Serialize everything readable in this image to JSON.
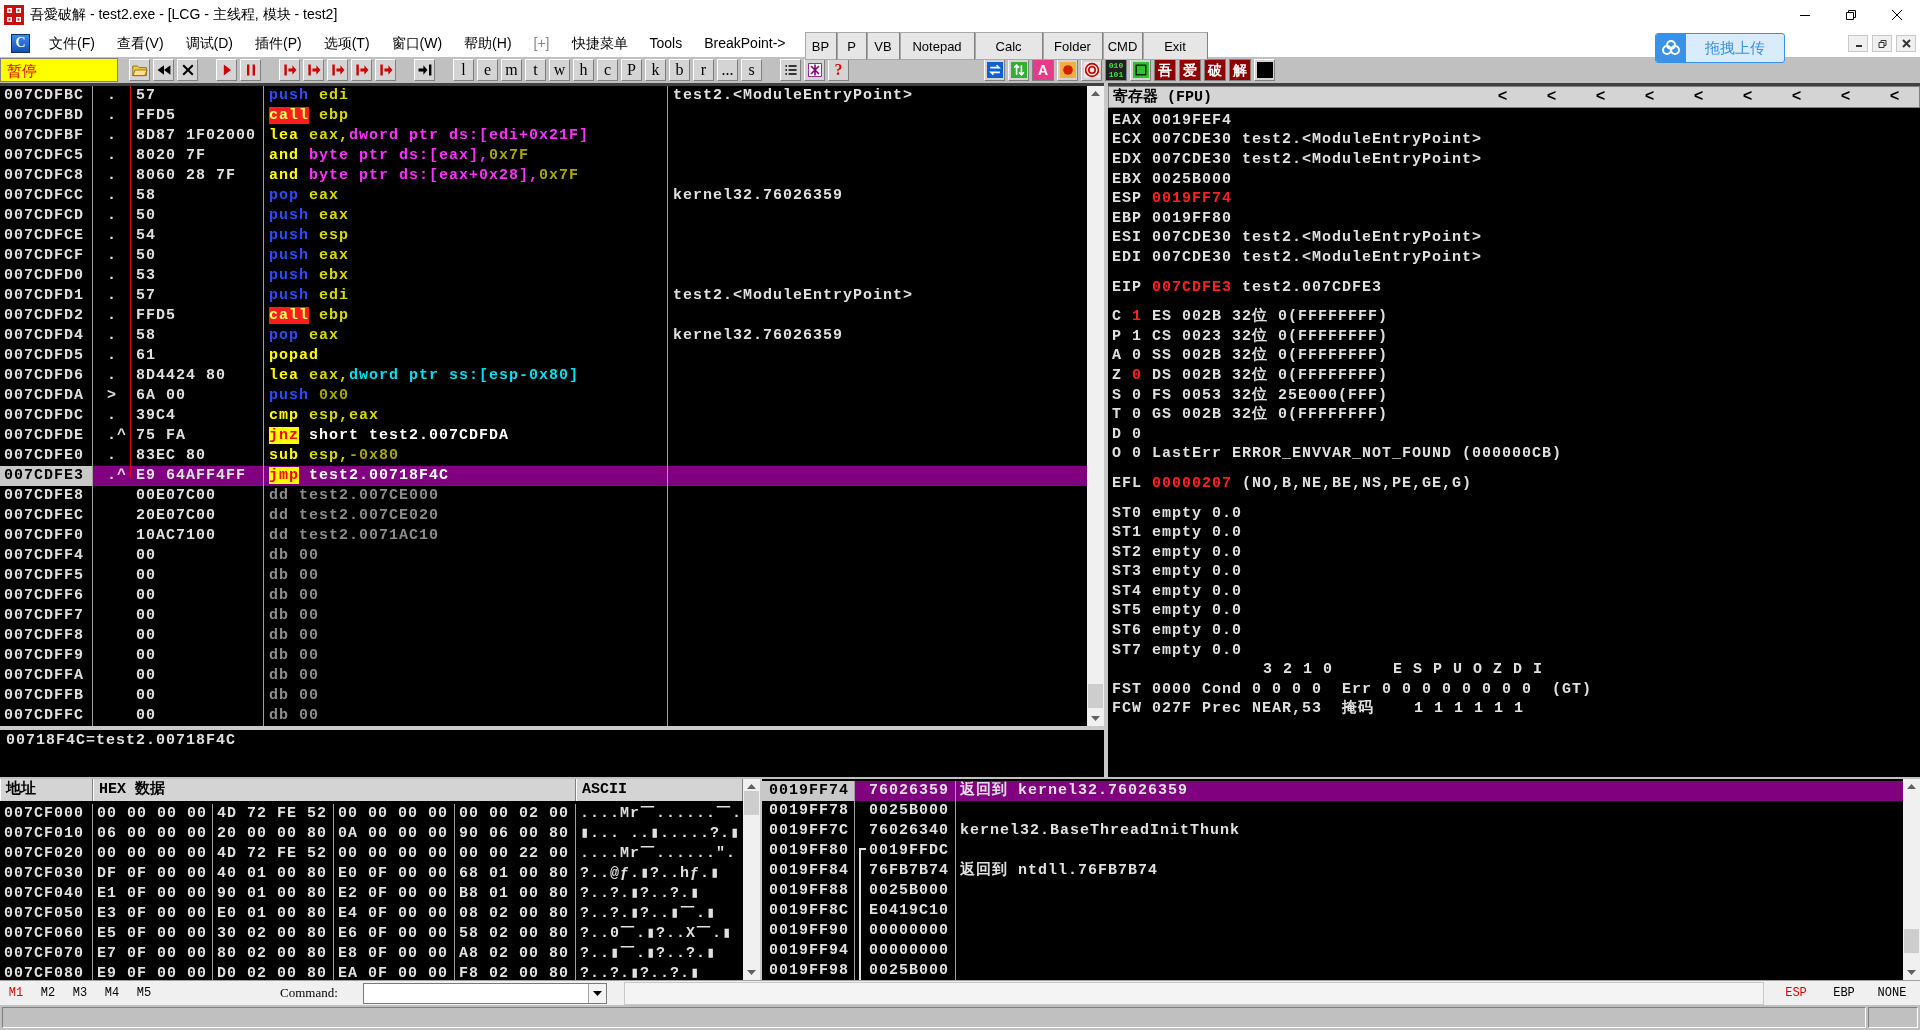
{
  "window": {
    "title": "吾愛破解 - test2.exe - [LCG -  主线程, 模块 - test2]"
  },
  "menu": {
    "badge": "C",
    "items": [
      {
        "label": "文件(F)",
        "disabled": false
      },
      {
        "label": "查看(V)",
        "disabled": false
      },
      {
        "label": "调试(D)",
        "disabled": false
      },
      {
        "label": "插件(P)",
        "disabled": false
      },
      {
        "label": "选项(T)",
        "disabled": false
      },
      {
        "label": "窗口(W)",
        "disabled": false
      },
      {
        "label": "帮助(H)",
        "disabled": false
      },
      {
        "label": "[+]",
        "disabled": true
      },
      {
        "label": "快捷菜单",
        "disabled": false
      },
      {
        "label": "Tools",
        "disabled": false
      },
      {
        "label": "BreakPoint->",
        "disabled": false
      }
    ],
    "quick_buttons": [
      "BP",
      "P",
      "VB",
      "Notepad",
      "Calc",
      "Folder",
      "CMD",
      "Exit"
    ],
    "upload_button": "拖拽上传"
  },
  "toolbar": {
    "status": "暂停",
    "letters": [
      "l",
      "e",
      "m",
      "t",
      "w",
      "h",
      "c",
      "P",
      "k",
      "b",
      "r",
      "...",
      "s"
    ],
    "help": "?",
    "badges": [
      "A",
      "010",
      "101",
      "吾",
      "爱",
      "破",
      "解"
    ]
  },
  "disassembly": {
    "rows": [
      {
        "address": "007CDFBC",
        "mark": ".",
        "hex": "57",
        "mnemonic": "push",
        "kind": "stack",
        "operands": [
          {
            "text": "edi",
            "kind": "reg"
          }
        ],
        "comment": "test2.<ModuleEntryPoint>",
        "selected": false
      },
      {
        "address": "007CDFBD",
        "mark": ".",
        "hex": "FFD5",
        "mnemonic": "call",
        "kind": "call",
        "operands": [
          {
            "text": "ebp",
            "kind": "reg"
          }
        ],
        "selected": false
      },
      {
        "address": "007CDFBF",
        "mark": ".",
        "hex": "8D87 1F02000",
        "mnemonic": "lea",
        "kind": "alu",
        "operands": [
          {
            "text": "eax,",
            "kind": "reg"
          },
          {
            "text": "dword ptr ds:[edi+0x21F]",
            "kind": "mem_ds"
          }
        ],
        "selected": false
      },
      {
        "address": "007CDFC5",
        "mark": ".",
        "hex": "8020 7F",
        "mnemonic": "and",
        "kind": "alu",
        "operands": [
          {
            "text": "byte ptr ds:[eax],",
            "kind": "mem_ds"
          },
          {
            "text": "0x7F",
            "kind": "imm"
          }
        ],
        "selected": false
      },
      {
        "address": "007CDFC8",
        "mark": ".",
        "hex": "8060 28 7F",
        "mnemonic": "and",
        "kind": "alu",
        "operands": [
          {
            "text": "byte ptr ds:[eax+0x28],",
            "kind": "mem_ds"
          },
          {
            "text": "0x7F",
            "kind": "imm"
          }
        ],
        "selected": false
      },
      {
        "address": "007CDFCC",
        "mark": ".",
        "hex": "58",
        "mnemonic": "pop",
        "kind": "stack",
        "operands": [
          {
            "text": "eax",
            "kind": "reg"
          }
        ],
        "comment": "kernel32.76026359",
        "selected": false
      },
      {
        "address": "007CDFCD",
        "mark": ".",
        "hex": "50",
        "mnemonic": "push",
        "kind": "stack",
        "operands": [
          {
            "text": "eax",
            "kind": "reg"
          }
        ],
        "selected": false
      },
      {
        "address": "007CDFCE",
        "mark": ".",
        "hex": "54",
        "mnemonic": "push",
        "kind": "stack",
        "operands": [
          {
            "text": "esp",
            "kind": "reg"
          }
        ],
        "selected": false
      },
      {
        "address": "007CDFCF",
        "mark": ".",
        "hex": "50",
        "mnemonic": "push",
        "kind": "stack",
        "operands": [
          {
            "text": "eax",
            "kind": "reg"
          }
        ],
        "selected": false
      },
      {
        "address": "007CDFD0",
        "mark": ".",
        "hex": "53",
        "mnemonic": "push",
        "kind": "stack",
        "operands": [
          {
            "text": "ebx",
            "kind": "reg"
          }
        ],
        "selected": false
      },
      {
        "address": "007CDFD1",
        "mark": ".",
        "hex": "57",
        "mnemonic": "push",
        "kind": "stack",
        "operands": [
          {
            "text": "edi",
            "kind": "reg"
          }
        ],
        "comment": "test2.<ModuleEntryPoint>",
        "selected": false
      },
      {
        "address": "007CDFD2",
        "mark": ".",
        "hex": "FFD5",
        "mnemonic": "call",
        "kind": "call",
        "operands": [
          {
            "text": "ebp",
            "kind": "reg"
          }
        ],
        "selected": false
      },
      {
        "address": "007CDFD4",
        "mark": ".",
        "hex": "58",
        "mnemonic": "pop",
        "kind": "stack",
        "operands": [
          {
            "text": "eax",
            "kind": "reg"
          }
        ],
        "comment": "kernel32.76026359",
        "selected": false
      },
      {
        "address": "007CDFD5",
        "mark": ".",
        "hex": "61",
        "mnemonic": "popad",
        "kind": "alu",
        "selected": false
      },
      {
        "address": "007CDFD6",
        "mark": ".",
        "hex": "8D4424 80",
        "mnemonic": "lea",
        "kind": "alu",
        "operands": [
          {
            "text": "eax,",
            "kind": "reg"
          },
          {
            "text": "dword ptr ss:[esp-0x80]",
            "kind": "mem_ss"
          }
        ],
        "selected": false
      },
      {
        "address": "007CDFDA",
        "mark": ">",
        "hex": "6A 00",
        "mnemonic": "push",
        "kind": "stack",
        "operands": [
          {
            "text": "0x0",
            "kind": "imm"
          }
        ],
        "selected": false
      },
      {
        "address": "007CDFDC",
        "mark": ".",
        "hex": "39C4",
        "mnemonic": "cmp",
        "kind": "alu",
        "operands": [
          {
            "text": "esp,eax",
            "kind": "reg"
          }
        ],
        "selected": false
      },
      {
        "address": "007CDFDE",
        "mark": ".^",
        "hex": "75 FA",
        "mnemonic": "jnz",
        "kind": "jump",
        "operands": [
          {
            "text": "short test2.007CDFDA",
            "kind": "target"
          }
        ],
        "selected": false
      },
      {
        "address": "007CDFE0",
        "mark": ".",
        "hex": "83EC 80",
        "mnemonic": "sub",
        "kind": "alu",
        "operands": [
          {
            "text": "esp,",
            "kind": "reg"
          },
          {
            "text": "-0x80",
            "kind": "imm"
          }
        ],
        "selected": false
      },
      {
        "address": "007CDFE3",
        "mark": ".^",
        "hex": "E9 64AFF4FF",
        "mnemonic": "jmp",
        "kind": "jump",
        "operands": [
          {
            "text": "test2.00718F4C",
            "kind": "target"
          }
        ],
        "selected": true
      },
      {
        "address": "007CDFE8",
        "hex": "00E07C00",
        "mnemonic": "dd",
        "kind": "data",
        "operands": [
          {
            "text": "test2.007CE000",
            "kind": "data"
          }
        ],
        "selected": false
      },
      {
        "address": "007CDFEC",
        "hex": "20E07C00",
        "mnemonic": "dd",
        "kind": "data",
        "operands": [
          {
            "text": "test2.007CE020",
            "kind": "data"
          }
        ],
        "selected": false
      },
      {
        "address": "007CDFF0",
        "hex": "10AC7100",
        "mnemonic": "dd",
        "kind": "data",
        "operands": [
          {
            "text": "test2.0071AC10",
            "kind": "data"
          }
        ],
        "selected": false
      },
      {
        "address": "007CDFF4",
        "hex": "00",
        "mnemonic": "db",
        "kind": "data",
        "operands": [
          {
            "text": "00",
            "kind": "data"
          }
        ],
        "selected": false
      },
      {
        "address": "007CDFF5",
        "hex": "00",
        "mnemonic": "db",
        "kind": "data",
        "operands": [
          {
            "text": "00",
            "kind": "data"
          }
        ],
        "selected": false
      },
      {
        "address": "007CDFF6",
        "hex": "00",
        "mnemonic": "db",
        "kind": "data",
        "operands": [
          {
            "text": "00",
            "kind": "data"
          }
        ],
        "selected": false
      },
      {
        "address": "007CDFF7",
        "hex": "00",
        "mnemonic": "db",
        "kind": "data",
        "operands": [
          {
            "text": "00",
            "kind": "data"
          }
        ],
        "selected": false
      },
      {
        "address": "007CDFF8",
        "hex": "00",
        "mnemonic": "db",
        "kind": "data",
        "operands": [
          {
            "text": "00",
            "kind": "data"
          }
        ],
        "selected": false
      },
      {
        "address": "007CDFF9",
        "hex": "00",
        "mnemonic": "db",
        "kind": "data",
        "operands": [
          {
            "text": "00",
            "kind": "data"
          }
        ],
        "selected": false
      },
      {
        "address": "007CDFFA",
        "hex": "00",
        "mnemonic": "db",
        "kind": "data",
        "operands": [
          {
            "text": "00",
            "kind": "data"
          }
        ],
        "selected": false
      },
      {
        "address": "007CDFFB",
        "hex": "00",
        "mnemonic": "db",
        "kind": "data",
        "operands": [
          {
            "text": "00",
            "kind": "data"
          }
        ],
        "selected": false
      },
      {
        "address": "007CDFFC",
        "hex": "00",
        "mnemonic": "db",
        "kind": "data",
        "operands": [
          {
            "text": "00",
            "kind": "data"
          }
        ],
        "selected": false
      }
    ],
    "info": "00718F4C=test2.00718F4C"
  },
  "registers": {
    "title": "寄存器 (FPU)",
    "arrows": [
      "<",
      "<",
      "<",
      "<",
      "<",
      "<",
      "<",
      "<",
      "<"
    ],
    "groups": [
      [
        {
          "label": "EAX",
          "value": "0019FEF4",
          "changed": false
        },
        {
          "label": "ECX",
          "value": "007CDE30",
          "changed": false,
          "comment": "test2.<ModuleEntryPoint>"
        },
        {
          "label": "EDX",
          "value": "007CDE30",
          "changed": false,
          "comment": "test2.<ModuleEntryPoint>"
        },
        {
          "label": "EBX",
          "value": "0025B000",
          "changed": false
        },
        {
          "label": "ESP",
          "value": "0019FF74",
          "changed": true
        },
        {
          "label": "EBP",
          "value": "0019FF80",
          "changed": false
        },
        {
          "label": "ESI",
          "value": "007CDE30",
          "changed": false,
          "comment": "test2.<ModuleEntryPoint>"
        },
        {
          "label": "EDI",
          "value": "007CDE30",
          "changed": false,
          "comment": "test2.<ModuleEntryPoint>"
        }
      ],
      [
        {
          "label": "EIP",
          "value": "007CDFE3",
          "changed": true,
          "comment": "test2.007CDFE3"
        }
      ],
      [
        {
          "label": "C",
          "value": "1",
          "changed": true,
          "comment": "ES 002B 32位 0(FFFFFFFF)"
        },
        {
          "label": "P",
          "value": "1",
          "changed": false,
          "comment": "CS 0023 32位 0(FFFFFFFF)"
        },
        {
          "label": "A",
          "value": "0",
          "changed": false,
          "comment": "SS 002B 32位 0(FFFFFFFF)"
        },
        {
          "label": "Z",
          "value": "0",
          "changed": true,
          "comment": "DS 002B 32位 0(FFFFFFFF)"
        },
        {
          "label": "S",
          "value": "0",
          "changed": false,
          "comment": "FS 0053 32位 25E000(FFF)"
        },
        {
          "label": "T",
          "value": "0",
          "changed": false,
          "comment": "GS 002B 32位 0(FFFFFFFF)"
        },
        {
          "label": "D",
          "value": "0",
          "changed": false
        },
        {
          "label": "O",
          "value": "0",
          "changed": false,
          "comment": "LastErr ERROR_ENVVAR_NOT_FOUND (000000CB)"
        }
      ],
      [
        {
          "label": "EFL",
          "value": "00000207",
          "changed": true,
          "comment": "(NO,B,NE,BE,NS,PE,GE,G)"
        }
      ],
      [
        {
          "label": "ST0",
          "comment": "empty 0.0"
        },
        {
          "label": "ST1",
          "comment": "empty 0.0"
        },
        {
          "label": "ST2",
          "comment": "empty 0.0"
        },
        {
          "label": "ST3",
          "comment": "empty 0.0"
        },
        {
          "label": "ST4",
          "comment": "empty 0.0"
        },
        {
          "label": "ST5",
          "comment": "empty 0.0"
        },
        {
          "label": "ST6",
          "comment": "empty 0.0"
        },
        {
          "label": "ST7",
          "comment": "empty 0.0"
        },
        {
          "comment": "3 2 1 0      E S P U O Z D I"
        },
        {
          "label": "FST",
          "value": "0000",
          "changed": false,
          "comment": "Cond 0 0 0 0  Err 0 0 0 0 0 0 0 0  (GT)"
        },
        {
          "label": "FCW",
          "value": "027F",
          "changed": false,
          "comment": "Prec NEAR,53  掩码    1 1 1 1 1 1"
        }
      ]
    ]
  },
  "dump": {
    "columns": [
      "地址",
      "HEX 数据",
      "ASCII"
    ],
    "rows": [
      {
        "address": "007CF000",
        "bytes": [
          "00 00 00 00",
          "4D 72 FE 52",
          "00 00 00 00",
          "00 00 02 00"
        ],
        "ascii": "....Mr￣......￣."
      },
      {
        "address": "007CF010",
        "bytes": [
          "06 00 00 00",
          "20 00 00 80",
          "0A 00 00 00",
          "90 06 00 80"
        ],
        "ascii": "▮... ..▮.....?.▮"
      },
      {
        "address": "007CF020",
        "bytes": [
          "00 00 00 00",
          "4D 72 FE 52",
          "00 00 00 00",
          "00 00 22 00"
        ],
        "ascii": "....Mr￣......\"."
      },
      {
        "address": "007CF030",
        "bytes": [
          "DF 0F 00 00",
          "40 01 00 80",
          "E0 0F 00 00",
          "68 01 00 80"
        ],
        "ascii": "?..@ƒ.▮?..hƒ.▮"
      },
      {
        "address": "007CF040",
        "bytes": [
          "E1 0F 00 00",
          "90 01 00 80",
          "E2 0F 00 00",
          "B8 01 00 80"
        ],
        "ascii": "?..?.▮?..?.▮"
      },
      {
        "address": "007CF050",
        "bytes": [
          "E3 0F 00 00",
          "E0 01 00 80",
          "E4 0F 00 00",
          "08 02 00 80"
        ],
        "ascii": "?..?.▮?..▮￣.▮"
      },
      {
        "address": "007CF060",
        "bytes": [
          "E5 0F 00 00",
          "30 02 00 80",
          "E6 0F 00 00",
          "58 02 00 80"
        ],
        "ascii": "?..0￣.▮?..X￣.▮"
      },
      {
        "address": "007CF070",
        "bytes": [
          "E7 0F 00 00",
          "80 02 00 80",
          "E8 0F 00 00",
          "A8 02 00 80"
        ],
        "ascii": "?..▮￣.▮?..?.▮"
      },
      {
        "address": "007CF080",
        "bytes": [
          "E9 0F 00 00",
          "D0 02 00 80",
          "EA 0F 00 00",
          "F8 02 00 80"
        ],
        "ascii": "?..?.▮?..?.▮"
      }
    ]
  },
  "stack": {
    "rows": [
      {
        "address": "0019FF74",
        "value": "76026359",
        "comment": "返回到 kernel32.76026359",
        "in_frame": false,
        "frame_start": false,
        "selected": true
      },
      {
        "address": "0019FF78",
        "value": "0025B000",
        "in_frame": false,
        "frame_start": false,
        "selected": false
      },
      {
        "address": "0019FF7C",
        "value": "76026340",
        "comment": "kernel32.BaseThreadInitThunk",
        "in_frame": false,
        "frame_start": false,
        "selected": false
      },
      {
        "address": "0019FF80",
        "value": "0019FFDC",
        "in_frame": true,
        "frame_start": true,
        "selected": false
      },
      {
        "address": "0019FF84",
        "value": "76FB7B74",
        "comment": "返回到 ntdll.76FB7B74",
        "in_frame": true,
        "frame_start": false,
        "selected": false
      },
      {
        "address": "0019FF88",
        "value": "0025B000",
        "in_frame": true,
        "frame_start": false,
        "selected": false
      },
      {
        "address": "0019FF8C",
        "value": "E0419C10",
        "in_frame": true,
        "frame_start": false,
        "selected": false
      },
      {
        "address": "0019FF90",
        "value": "00000000",
        "in_frame": true,
        "frame_start": false,
        "selected": false
      },
      {
        "address": "0019FF94",
        "value": "00000000",
        "in_frame": true,
        "frame_start": false,
        "selected": false
      },
      {
        "address": "0019FF98",
        "value": "0025B000",
        "in_frame": true,
        "frame_start": false,
        "selected": false
      }
    ]
  },
  "command_bar": {
    "markers": [
      {
        "label": "M1",
        "selected": true
      },
      {
        "label": "M2",
        "selected": false
      },
      {
        "label": "M3",
        "selected": false
      },
      {
        "label": "M4",
        "selected": false
      },
      {
        "label": "M5",
        "selected": false
      }
    ],
    "command_label": "Command:",
    "registers": [
      {
        "label": "ESP",
        "selected": true
      },
      {
        "label": "EBP",
        "selected": false
      },
      {
        "label": "NONE",
        "selected": false
      }
    ]
  }
}
